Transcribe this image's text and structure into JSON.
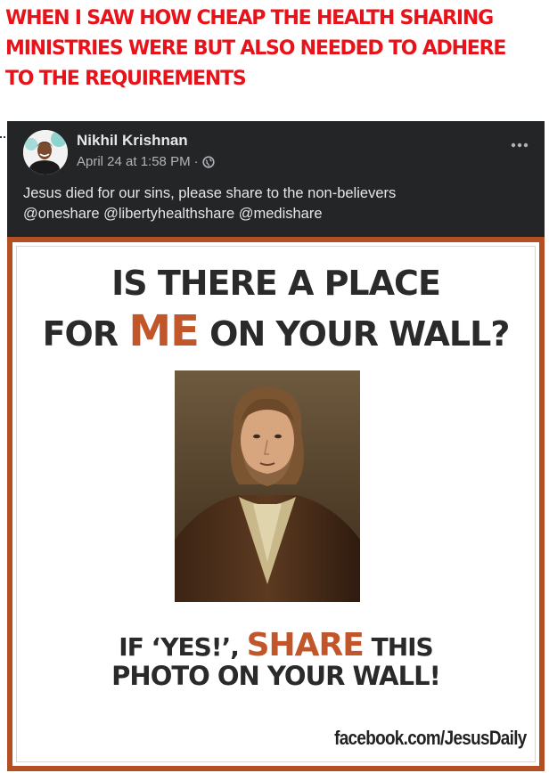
{
  "caption": {
    "text": "WHEN I SAW HOW CHEAP THE HEALTH SHARING\nMINISTRIES WERE BUT ALSO NEEDED TO ADHERE\nTO THE REQUIREMENTS",
    "color": "#e8131a"
  },
  "post": {
    "author": "Nikhil Krishnan",
    "timestamp": "April 24 at 1:58 PM",
    "separator": "·",
    "privacy_icon": "globe-icon",
    "more_icon": "more-options-icon",
    "text_line_1": "Jesus died for our sins, please share to the non-believers",
    "text_line_2": "@oneshare @libertyhealthshare @medishare",
    "background": "#242526"
  },
  "meme": {
    "headline_line1": "IS THERE A PLACE",
    "headline_for": "FOR ",
    "headline_me": "ME",
    "headline_rest": " ON YOUR WALL?",
    "share_prefix": "IF ‘YES!’, ",
    "share_word": "SHARE",
    "share_suffix": " THIS",
    "share_line2": "PHOTO ON YOUR WALL!",
    "watermark": "facebook.com/JesusDaily",
    "frame_color": "#b44f22",
    "accent_color": "#c2562b"
  }
}
